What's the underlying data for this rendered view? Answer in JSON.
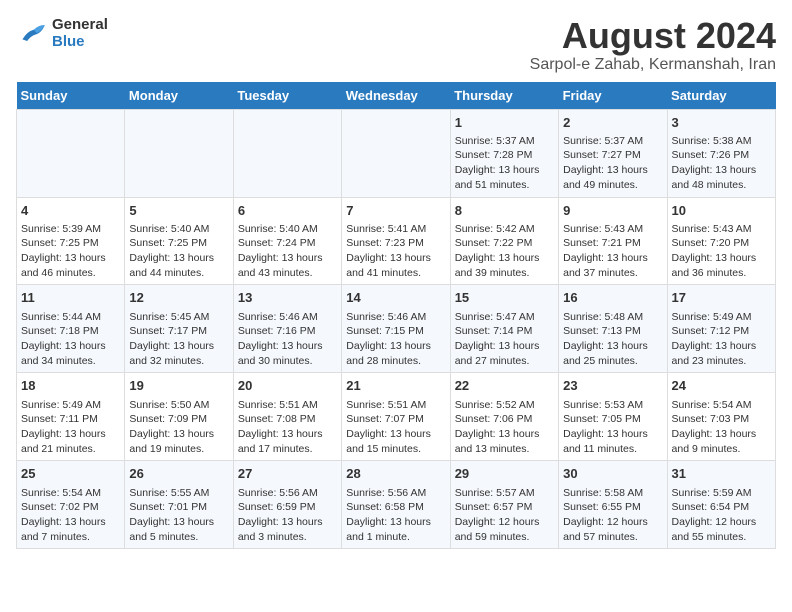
{
  "header": {
    "logo_line1": "General",
    "logo_line2": "Blue",
    "title": "August 2024",
    "subtitle": "Sarpol-e Zahab, Kermanshah, Iran"
  },
  "days_of_week": [
    "Sunday",
    "Monday",
    "Tuesday",
    "Wednesday",
    "Thursday",
    "Friday",
    "Saturday"
  ],
  "weeks": [
    [
      {
        "day": "",
        "info": ""
      },
      {
        "day": "",
        "info": ""
      },
      {
        "day": "",
        "info": ""
      },
      {
        "day": "",
        "info": ""
      },
      {
        "day": "1",
        "info": "Sunrise: 5:37 AM\nSunset: 7:28 PM\nDaylight: 13 hours\nand 51 minutes."
      },
      {
        "day": "2",
        "info": "Sunrise: 5:37 AM\nSunset: 7:27 PM\nDaylight: 13 hours\nand 49 minutes."
      },
      {
        "day": "3",
        "info": "Sunrise: 5:38 AM\nSunset: 7:26 PM\nDaylight: 13 hours\nand 48 minutes."
      }
    ],
    [
      {
        "day": "4",
        "info": "Sunrise: 5:39 AM\nSunset: 7:25 PM\nDaylight: 13 hours\nand 46 minutes."
      },
      {
        "day": "5",
        "info": "Sunrise: 5:40 AM\nSunset: 7:25 PM\nDaylight: 13 hours\nand 44 minutes."
      },
      {
        "day": "6",
        "info": "Sunrise: 5:40 AM\nSunset: 7:24 PM\nDaylight: 13 hours\nand 43 minutes."
      },
      {
        "day": "7",
        "info": "Sunrise: 5:41 AM\nSunset: 7:23 PM\nDaylight: 13 hours\nand 41 minutes."
      },
      {
        "day": "8",
        "info": "Sunrise: 5:42 AM\nSunset: 7:22 PM\nDaylight: 13 hours\nand 39 minutes."
      },
      {
        "day": "9",
        "info": "Sunrise: 5:43 AM\nSunset: 7:21 PM\nDaylight: 13 hours\nand 37 minutes."
      },
      {
        "day": "10",
        "info": "Sunrise: 5:43 AM\nSunset: 7:20 PM\nDaylight: 13 hours\nand 36 minutes."
      }
    ],
    [
      {
        "day": "11",
        "info": "Sunrise: 5:44 AM\nSunset: 7:18 PM\nDaylight: 13 hours\nand 34 minutes."
      },
      {
        "day": "12",
        "info": "Sunrise: 5:45 AM\nSunset: 7:17 PM\nDaylight: 13 hours\nand 32 minutes."
      },
      {
        "day": "13",
        "info": "Sunrise: 5:46 AM\nSunset: 7:16 PM\nDaylight: 13 hours\nand 30 minutes."
      },
      {
        "day": "14",
        "info": "Sunrise: 5:46 AM\nSunset: 7:15 PM\nDaylight: 13 hours\nand 28 minutes."
      },
      {
        "day": "15",
        "info": "Sunrise: 5:47 AM\nSunset: 7:14 PM\nDaylight: 13 hours\nand 27 minutes."
      },
      {
        "day": "16",
        "info": "Sunrise: 5:48 AM\nSunset: 7:13 PM\nDaylight: 13 hours\nand 25 minutes."
      },
      {
        "day": "17",
        "info": "Sunrise: 5:49 AM\nSunset: 7:12 PM\nDaylight: 13 hours\nand 23 minutes."
      }
    ],
    [
      {
        "day": "18",
        "info": "Sunrise: 5:49 AM\nSunset: 7:11 PM\nDaylight: 13 hours\nand 21 minutes."
      },
      {
        "day": "19",
        "info": "Sunrise: 5:50 AM\nSunset: 7:09 PM\nDaylight: 13 hours\nand 19 minutes."
      },
      {
        "day": "20",
        "info": "Sunrise: 5:51 AM\nSunset: 7:08 PM\nDaylight: 13 hours\nand 17 minutes."
      },
      {
        "day": "21",
        "info": "Sunrise: 5:51 AM\nSunset: 7:07 PM\nDaylight: 13 hours\nand 15 minutes."
      },
      {
        "day": "22",
        "info": "Sunrise: 5:52 AM\nSunset: 7:06 PM\nDaylight: 13 hours\nand 13 minutes."
      },
      {
        "day": "23",
        "info": "Sunrise: 5:53 AM\nSunset: 7:05 PM\nDaylight: 13 hours\nand 11 minutes."
      },
      {
        "day": "24",
        "info": "Sunrise: 5:54 AM\nSunset: 7:03 PM\nDaylight: 13 hours\nand 9 minutes."
      }
    ],
    [
      {
        "day": "25",
        "info": "Sunrise: 5:54 AM\nSunset: 7:02 PM\nDaylight: 13 hours\nand 7 minutes."
      },
      {
        "day": "26",
        "info": "Sunrise: 5:55 AM\nSunset: 7:01 PM\nDaylight: 13 hours\nand 5 minutes."
      },
      {
        "day": "27",
        "info": "Sunrise: 5:56 AM\nSunset: 6:59 PM\nDaylight: 13 hours\nand 3 minutes."
      },
      {
        "day": "28",
        "info": "Sunrise: 5:56 AM\nSunset: 6:58 PM\nDaylight: 13 hours\nand 1 minute."
      },
      {
        "day": "29",
        "info": "Sunrise: 5:57 AM\nSunset: 6:57 PM\nDaylight: 12 hours\nand 59 minutes."
      },
      {
        "day": "30",
        "info": "Sunrise: 5:58 AM\nSunset: 6:55 PM\nDaylight: 12 hours\nand 57 minutes."
      },
      {
        "day": "31",
        "info": "Sunrise: 5:59 AM\nSunset: 6:54 PM\nDaylight: 12 hours\nand 55 minutes."
      }
    ]
  ]
}
